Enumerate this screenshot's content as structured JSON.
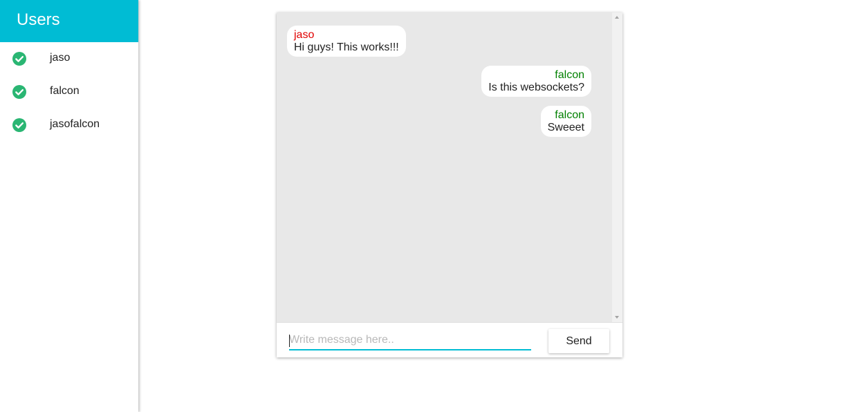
{
  "sidebar": {
    "title": "Users",
    "status_icon": "check-circle-icon",
    "status_color": "#2ab673",
    "users": [
      {
        "name": "jaso"
      },
      {
        "name": "falcon"
      },
      {
        "name": "jasofalcon"
      }
    ]
  },
  "chat": {
    "messages": [
      {
        "author": "jaso",
        "text": "Hi guys! This works!!!",
        "side": "left",
        "author_color": "#e00000"
      },
      {
        "author": "falcon",
        "text": "Is this websockets?",
        "side": "right",
        "author_color": "#008000"
      },
      {
        "author": "falcon",
        "text": "Sweeet",
        "side": "right",
        "author_color": "#008000"
      }
    ],
    "input": {
      "value": "",
      "placeholder": "Write message here.."
    },
    "send_label": "Send"
  },
  "colors": {
    "accent": "#00bcd4",
    "messages_bg": "#e8e8e8"
  }
}
